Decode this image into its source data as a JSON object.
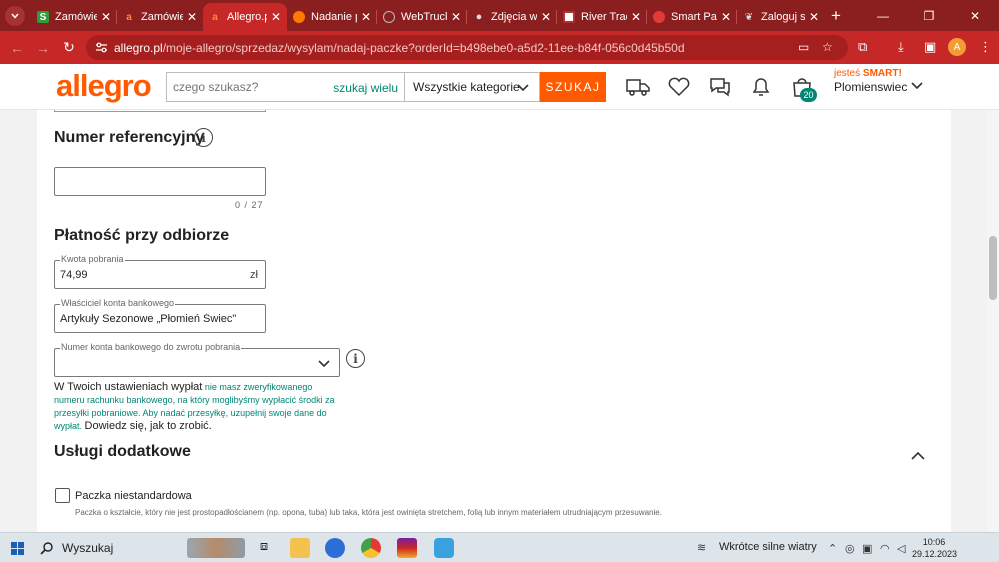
{
  "browser": {
    "tabs": [
      {
        "label": "Zamówie",
        "favicon": "green-square",
        "color": "#2e9d3a",
        "active": false
      },
      {
        "label": "Zamówie",
        "favicon": "allegro-a",
        "color": "#ff5a00",
        "active": false
      },
      {
        "label": "Allegro.pl",
        "favicon": "allegro-a",
        "color": "#ff5a00",
        "active": true
      },
      {
        "label": "Nadanie p",
        "favicon": "orange-circle",
        "color": "#ff7a00",
        "active": false
      },
      {
        "label": "WebTruck",
        "favicon": "globe",
        "color": "#888888",
        "active": false
      },
      {
        "label": "Zdjęcia w",
        "favicon": "apple",
        "color": "#dddddd",
        "active": false
      },
      {
        "label": "River Trad",
        "favicon": "box",
        "color": "#ffffff",
        "active": false
      },
      {
        "label": "Smart Pac",
        "favicon": "red-circle",
        "color": "#e53935",
        "active": false
      },
      {
        "label": "Zaloguj si",
        "favicon": "leaf",
        "color": "#ffffff",
        "active": false
      }
    ],
    "url_domain": "allegro.pl",
    "url_path": "/moje-allegro/sprzedaz/wysylam/nadaj-paczke?orderId=b498ebe0-a5d2-11ee-b84f-056c0d45b50d",
    "profile_initial": "A"
  },
  "header": {
    "logo": "allegro",
    "search_placeholder": "czego szukasz?",
    "search_many": "szukaj wielu",
    "category": "Wszystkie kategorie",
    "search_button": "SZUKAJ",
    "cart_count": "20",
    "smart_prefix": "jesteś",
    "smart_brand": "SMART",
    "username": "Plomienswiec"
  },
  "form": {
    "ref_title": "Numer referencyjny",
    "ref_counter": "0 / 27",
    "cod_title": "Płatność przy odbiorze",
    "amount_label": "Kwota pobrania",
    "amount_value": "74,99",
    "amount_currency": "zł",
    "owner_label": "Właściciel konta bankowego",
    "owner_value": "Artykuły Sezonowe „Płomień Świec\" S",
    "account_label": "Numer konta bankowego do zwrotu pobrania",
    "notice_part1": "W Twoich ustawieniach wypłat",
    "notice_part2": "nie masz zweryfikowanego numeru rachunku bankowego, na który moglibyśmy wypłacić środki za przesyłki pobraniowe. Aby nadać przesyłkę, uzupełnij swoje dane do wypłat.",
    "notice_link": "Dowiedz się, jak to zrobić.",
    "extra_title": "Usługi dodatkowe",
    "nonstandard_label": "Paczka niestandardowa",
    "nonstandard_desc": "Paczka o kształcie, który nie jest prostopadłościanem (np. opona, tuba) lub taka, która jest owinięta stretchem, folią lub innym materiałem utrudniającym przesuwanie."
  },
  "taskbar": {
    "search_text": "Wyszukaj",
    "weather": "Wkrótce silne wiatry",
    "time": "10:06",
    "date": "29.12.2023"
  },
  "colors": {
    "allegro_orange": "#ff5a00",
    "allegro_teal": "#008673",
    "browser_red": "#c62828"
  }
}
